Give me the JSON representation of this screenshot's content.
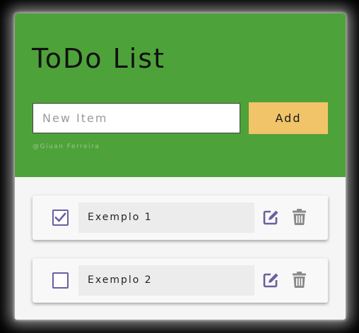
{
  "header": {
    "title": "ToDo List",
    "new_item_placeholder": "New Item",
    "new_item_value": "",
    "add_label": "Add",
    "credit": "@Giuan Ferreira"
  },
  "items": [
    {
      "label": "Exemplo 1",
      "checked": true
    },
    {
      "label": "Exemplo 2",
      "checked": false
    }
  ],
  "colors": {
    "header_bg": "#4ea23a",
    "add_button": "#f1c46a",
    "icon_purple": "#6a5fa0",
    "icon_gray": "#8a8a8a"
  },
  "icons": [
    "check-icon",
    "edit-icon",
    "trash-icon"
  ]
}
